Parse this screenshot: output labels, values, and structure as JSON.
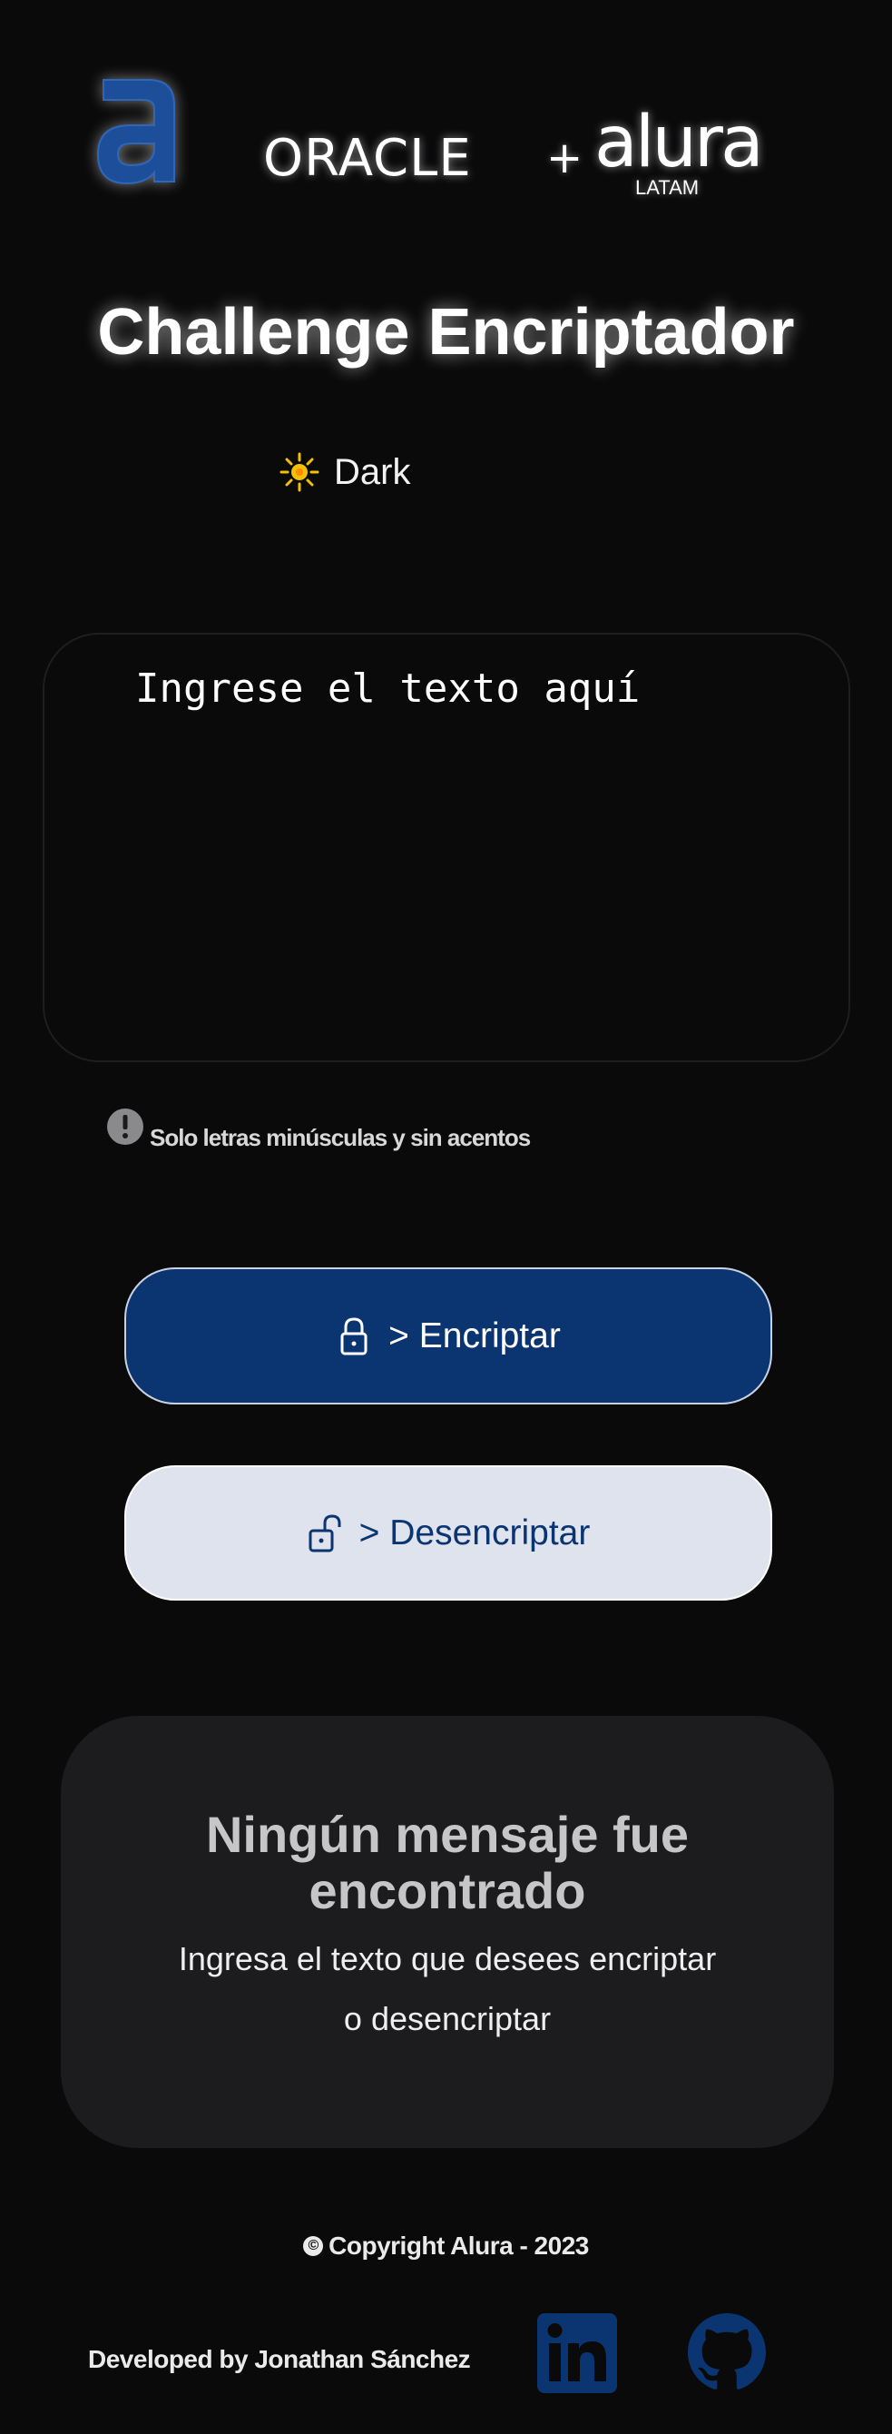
{
  "header": {
    "logo_letter": "a",
    "oracle": "ORACLE",
    "plus": "+",
    "alura": "alura",
    "latam": "LATAM",
    "title": "Challenge Encriptador"
  },
  "theme_toggle": {
    "icon": "sun-icon",
    "label": "Dark"
  },
  "input": {
    "placeholder": "Ingrese el texto aquí",
    "value": ""
  },
  "hint": {
    "icon": "info-icon",
    "text": "Solo letras minúsculas y sin acentos"
  },
  "buttons": {
    "encrypt": {
      "icon": "lock-icon",
      "label": "> Encriptar"
    },
    "decrypt": {
      "icon": "unlock-icon",
      "label": "> Desencriptar"
    }
  },
  "output": {
    "title": "Ningún mensaje fue encontrado",
    "subtitle_line1": "Ingresa el texto que desees encriptar",
    "subtitle_line2": "o desencriptar"
  },
  "footer": {
    "copyright_symbol": "©",
    "copyright": "Copyright Alura - 2023",
    "developed_by": "Developed by Jonathan Sánchez",
    "social": [
      {
        "icon": "linkedin-icon"
      },
      {
        "icon": "github-icon"
      }
    ]
  },
  "colors": {
    "background": "#0a0a0b",
    "encrypt_button": "#0b3570",
    "decrypt_button": "#dfe3ee",
    "output_card": "#1c1c1e",
    "logo_blue": "#1d4e9a",
    "sun_yellow": "#f2c100",
    "linkedin_blue": "#0b3570"
  }
}
